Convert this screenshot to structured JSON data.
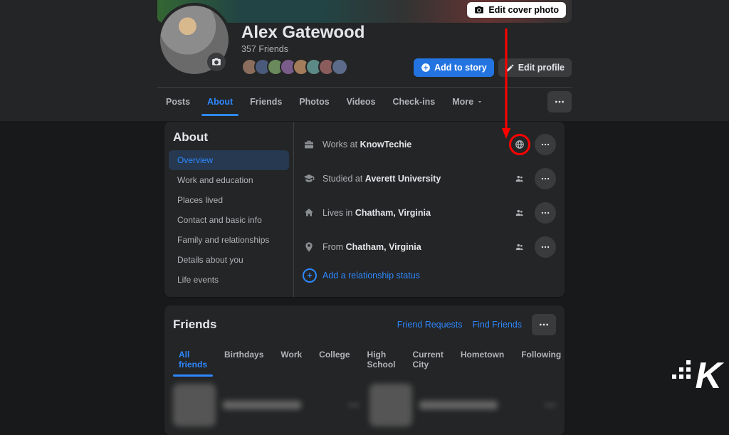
{
  "cover": {
    "edit_label": "Edit cover photo"
  },
  "profile": {
    "name": "Alex Gatewood",
    "friends_count": "357 Friends"
  },
  "actions": {
    "add_to_story": "Add to story",
    "edit_profile": "Edit profile"
  },
  "tabs": {
    "posts": "Posts",
    "about": "About",
    "friends": "Friends",
    "photos": "Photos",
    "videos": "Videos",
    "checkins": "Check-ins",
    "more": "More"
  },
  "about": {
    "title": "About",
    "items": {
      "overview": "Overview",
      "work_education": "Work and education",
      "places_lived": "Places lived",
      "contact": "Contact and basic info",
      "family": "Family and relationships",
      "details": "Details about you",
      "life_events": "Life events"
    },
    "overview": {
      "work_prefix": "Works at ",
      "work_value": "KnowTechie",
      "study_prefix": "Studied at ",
      "study_value": "Averett University",
      "lives_prefix": "Lives in ",
      "lives_value": "Chatham, Virginia",
      "from_prefix": "From ",
      "from_value": "Chatham, Virginia",
      "add_relationship": "Add a relationship status"
    }
  },
  "friends_section": {
    "title": "Friends",
    "friend_requests": "Friend Requests",
    "find_friends": "Find Friends",
    "tabs": {
      "all": "All friends",
      "birthdays": "Birthdays",
      "work": "Work",
      "college": "College",
      "highschool": "High School",
      "current_city": "Current City",
      "hometown": "Hometown",
      "following": "Following"
    }
  },
  "friend_bubble_colors": [
    "#8a6d5c",
    "#4a5a7a",
    "#6b8a5c",
    "#7a5c8a",
    "#a37c5b",
    "#5c8a86",
    "#8a5c5c",
    "#5c6b8a"
  ]
}
